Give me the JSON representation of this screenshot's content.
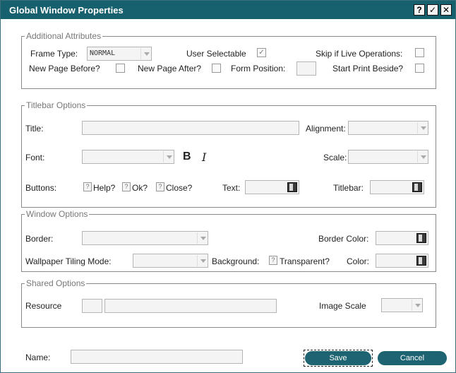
{
  "window": {
    "title": "Global Window Properties",
    "help_label": "?",
    "ok_label": "✓",
    "close_label": "✕"
  },
  "additional": {
    "legend": "Additional Attributes",
    "frame_type_label": "Frame Type:",
    "frame_type_value": "NORMAL",
    "user_selectable_label": "User Selectable",
    "user_selectable_checked": true,
    "skip_live_label": "Skip if Live Operations:",
    "new_page_before_label": "New Page Before?",
    "new_page_after_label": "New Page After?",
    "form_position_label": "Form Position:",
    "start_print_beside_label": "Start Print Beside?"
  },
  "titlebar_options": {
    "legend": "Titlebar Options",
    "title_label": "Title:",
    "alignment_label": "Alignment:",
    "font_label": "Font:",
    "bold_label": "B",
    "italic_label": "I",
    "scale_label": "Scale:",
    "buttons_label": "Buttons:",
    "help_label": "Help?",
    "ok_label": "Ok?",
    "close_label": "Close?",
    "text_label": "Text:",
    "titlebar_label": "Titlebar:",
    "qmark": "?"
  },
  "window_options": {
    "legend": "Window Options",
    "border_label": "Border:",
    "border_color_label": "Border Color:",
    "wallpaper_label": "Wallpaper Tiling Mode:",
    "background_label": "Background:",
    "transparent_label": "Transparent?",
    "color_label": "Color:",
    "qmark": "?"
  },
  "shared_options": {
    "legend": "Shared Options",
    "resource_label": "Resource",
    "image_scale_label": "Image Scale"
  },
  "footer": {
    "name_label": "Name:",
    "save_label": "Save",
    "cancel_label": "Cancel"
  },
  "colors": {
    "titlebar": "#17606d",
    "button": "#1d6371"
  }
}
